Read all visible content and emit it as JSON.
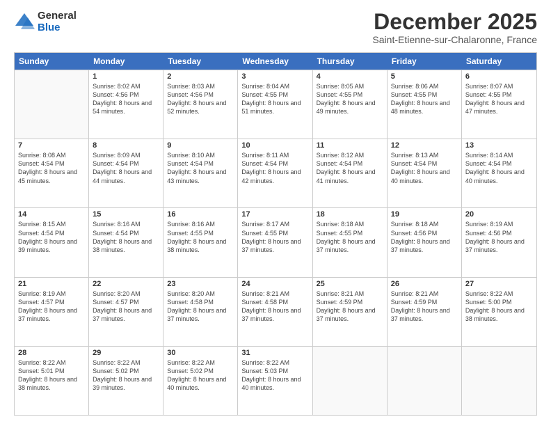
{
  "logo": {
    "general": "General",
    "blue": "Blue"
  },
  "title": "December 2025",
  "subtitle": "Saint-Etienne-sur-Chalaronne, France",
  "days_of_week": [
    "Sunday",
    "Monday",
    "Tuesday",
    "Wednesday",
    "Thursday",
    "Friday",
    "Saturday"
  ],
  "weeks": [
    [
      {
        "day": "",
        "sunrise": "",
        "sunset": "",
        "daylight": ""
      },
      {
        "day": "1",
        "sunrise": "Sunrise: 8:02 AM",
        "sunset": "Sunset: 4:56 PM",
        "daylight": "Daylight: 8 hours and 54 minutes."
      },
      {
        "day": "2",
        "sunrise": "Sunrise: 8:03 AM",
        "sunset": "Sunset: 4:56 PM",
        "daylight": "Daylight: 8 hours and 52 minutes."
      },
      {
        "day": "3",
        "sunrise": "Sunrise: 8:04 AM",
        "sunset": "Sunset: 4:55 PM",
        "daylight": "Daylight: 8 hours and 51 minutes."
      },
      {
        "day": "4",
        "sunrise": "Sunrise: 8:05 AM",
        "sunset": "Sunset: 4:55 PM",
        "daylight": "Daylight: 8 hours and 49 minutes."
      },
      {
        "day": "5",
        "sunrise": "Sunrise: 8:06 AM",
        "sunset": "Sunset: 4:55 PM",
        "daylight": "Daylight: 8 hours and 48 minutes."
      },
      {
        "day": "6",
        "sunrise": "Sunrise: 8:07 AM",
        "sunset": "Sunset: 4:55 PM",
        "daylight": "Daylight: 8 hours and 47 minutes."
      }
    ],
    [
      {
        "day": "7",
        "sunrise": "Sunrise: 8:08 AM",
        "sunset": "Sunset: 4:54 PM",
        "daylight": "Daylight: 8 hours and 45 minutes."
      },
      {
        "day": "8",
        "sunrise": "Sunrise: 8:09 AM",
        "sunset": "Sunset: 4:54 PM",
        "daylight": "Daylight: 8 hours and 44 minutes."
      },
      {
        "day": "9",
        "sunrise": "Sunrise: 8:10 AM",
        "sunset": "Sunset: 4:54 PM",
        "daylight": "Daylight: 8 hours and 43 minutes."
      },
      {
        "day": "10",
        "sunrise": "Sunrise: 8:11 AM",
        "sunset": "Sunset: 4:54 PM",
        "daylight": "Daylight: 8 hours and 42 minutes."
      },
      {
        "day": "11",
        "sunrise": "Sunrise: 8:12 AM",
        "sunset": "Sunset: 4:54 PM",
        "daylight": "Daylight: 8 hours and 41 minutes."
      },
      {
        "day": "12",
        "sunrise": "Sunrise: 8:13 AM",
        "sunset": "Sunset: 4:54 PM",
        "daylight": "Daylight: 8 hours and 40 minutes."
      },
      {
        "day": "13",
        "sunrise": "Sunrise: 8:14 AM",
        "sunset": "Sunset: 4:54 PM",
        "daylight": "Daylight: 8 hours and 40 minutes."
      }
    ],
    [
      {
        "day": "14",
        "sunrise": "Sunrise: 8:15 AM",
        "sunset": "Sunset: 4:54 PM",
        "daylight": "Daylight: 8 hours and 39 minutes."
      },
      {
        "day": "15",
        "sunrise": "Sunrise: 8:16 AM",
        "sunset": "Sunset: 4:54 PM",
        "daylight": "Daylight: 8 hours and 38 minutes."
      },
      {
        "day": "16",
        "sunrise": "Sunrise: 8:16 AM",
        "sunset": "Sunset: 4:55 PM",
        "daylight": "Daylight: 8 hours and 38 minutes."
      },
      {
        "day": "17",
        "sunrise": "Sunrise: 8:17 AM",
        "sunset": "Sunset: 4:55 PM",
        "daylight": "Daylight: 8 hours and 37 minutes."
      },
      {
        "day": "18",
        "sunrise": "Sunrise: 8:18 AM",
        "sunset": "Sunset: 4:55 PM",
        "daylight": "Daylight: 8 hours and 37 minutes."
      },
      {
        "day": "19",
        "sunrise": "Sunrise: 8:18 AM",
        "sunset": "Sunset: 4:56 PM",
        "daylight": "Daylight: 8 hours and 37 minutes."
      },
      {
        "day": "20",
        "sunrise": "Sunrise: 8:19 AM",
        "sunset": "Sunset: 4:56 PM",
        "daylight": "Daylight: 8 hours and 37 minutes."
      }
    ],
    [
      {
        "day": "21",
        "sunrise": "Sunrise: 8:19 AM",
        "sunset": "Sunset: 4:57 PM",
        "daylight": "Daylight: 8 hours and 37 minutes."
      },
      {
        "day": "22",
        "sunrise": "Sunrise: 8:20 AM",
        "sunset": "Sunset: 4:57 PM",
        "daylight": "Daylight: 8 hours and 37 minutes."
      },
      {
        "day": "23",
        "sunrise": "Sunrise: 8:20 AM",
        "sunset": "Sunset: 4:58 PM",
        "daylight": "Daylight: 8 hours and 37 minutes."
      },
      {
        "day": "24",
        "sunrise": "Sunrise: 8:21 AM",
        "sunset": "Sunset: 4:58 PM",
        "daylight": "Daylight: 8 hours and 37 minutes."
      },
      {
        "day": "25",
        "sunrise": "Sunrise: 8:21 AM",
        "sunset": "Sunset: 4:59 PM",
        "daylight": "Daylight: 8 hours and 37 minutes."
      },
      {
        "day": "26",
        "sunrise": "Sunrise: 8:21 AM",
        "sunset": "Sunset: 4:59 PM",
        "daylight": "Daylight: 8 hours and 37 minutes."
      },
      {
        "day": "27",
        "sunrise": "Sunrise: 8:22 AM",
        "sunset": "Sunset: 5:00 PM",
        "daylight": "Daylight: 8 hours and 38 minutes."
      }
    ],
    [
      {
        "day": "28",
        "sunrise": "Sunrise: 8:22 AM",
        "sunset": "Sunset: 5:01 PM",
        "daylight": "Daylight: 8 hours and 38 minutes."
      },
      {
        "day": "29",
        "sunrise": "Sunrise: 8:22 AM",
        "sunset": "Sunset: 5:02 PM",
        "daylight": "Daylight: 8 hours and 39 minutes."
      },
      {
        "day": "30",
        "sunrise": "Sunrise: 8:22 AM",
        "sunset": "Sunset: 5:02 PM",
        "daylight": "Daylight: 8 hours and 40 minutes."
      },
      {
        "day": "31",
        "sunrise": "Sunrise: 8:22 AM",
        "sunset": "Sunset: 5:03 PM",
        "daylight": "Daylight: 8 hours and 40 minutes."
      },
      {
        "day": "",
        "sunrise": "",
        "sunset": "",
        "daylight": ""
      },
      {
        "day": "",
        "sunrise": "",
        "sunset": "",
        "daylight": ""
      },
      {
        "day": "",
        "sunrise": "",
        "sunset": "",
        "daylight": ""
      }
    ]
  ]
}
